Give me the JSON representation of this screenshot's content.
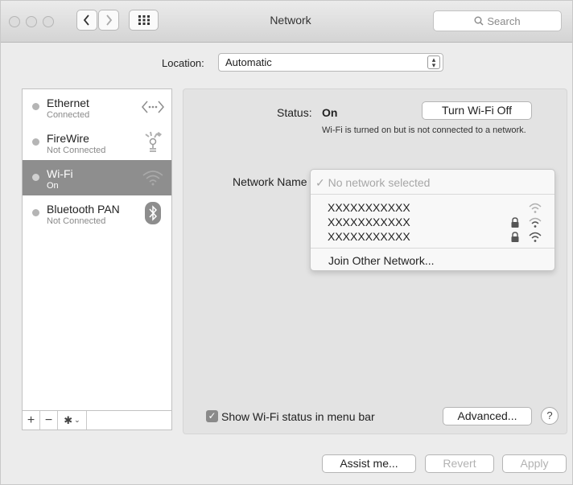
{
  "window": {
    "title": "Network",
    "search_placeholder": "Search"
  },
  "location": {
    "label": "Location:",
    "value": "Automatic"
  },
  "sidebar": {
    "services": [
      {
        "name": "Ethernet",
        "status": "Connected",
        "icon": "ethernet-icon"
      },
      {
        "name": "FireWire",
        "status": "Not Connected",
        "icon": "firewire-icon"
      },
      {
        "name": "Wi-Fi",
        "status": "On",
        "icon": "wifi-icon",
        "selected": true
      },
      {
        "name": "Bluetooth PAN",
        "status": "Not Connected",
        "icon": "bluetooth-icon"
      }
    ],
    "toolbar": {
      "add": "+",
      "remove": "−"
    }
  },
  "detail": {
    "status_label": "Status:",
    "status_value": "On",
    "toggle_button": "Turn Wi-Fi Off",
    "status_description": "Wi-Fi is turned on but is not connected to a network.",
    "network_name_label": "Network Name",
    "network_menu": {
      "selected": "No network selected",
      "networks": [
        {
          "name": "XXXXXXXXXXX",
          "locked": false
        },
        {
          "name": "XXXXXXXXXXX",
          "locked": true
        },
        {
          "name": "XXXXXXXXXXX",
          "locked": true
        }
      ],
      "join_other": "Join Other Network..."
    },
    "show_status_label": "Show Wi-Fi status in menu bar",
    "show_status_checked": true,
    "advanced_button": "Advanced...",
    "help_button": "?"
  },
  "footer": {
    "assist_button": "Assist me...",
    "revert_button": "Revert",
    "apply_button": "Apply"
  }
}
